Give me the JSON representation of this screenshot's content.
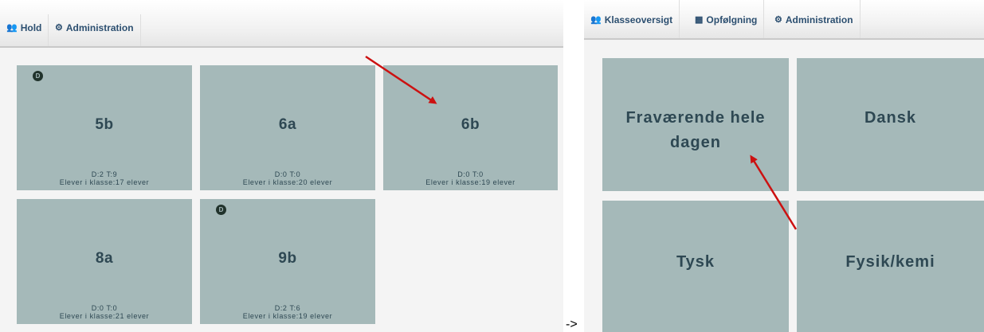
{
  "left_screen": {
    "nav": [
      {
        "icon": "users-icon",
        "label": "Hold"
      },
      {
        "icon": "gear-icon",
        "label": "Administration"
      }
    ],
    "badge_label": "D",
    "classes": [
      {
        "name": "5b",
        "stats": "D:2 T:9",
        "students": "Elever i klasse:17 elever",
        "badge": true
      },
      {
        "name": "6a",
        "stats": "D:0 T:0",
        "students": "Elever i klasse:20 elever",
        "badge": false
      },
      {
        "name": "6b",
        "stats": "D:0 T:0",
        "students": "Elever i klasse:19 elever",
        "badge": false
      },
      {
        "name": "8a",
        "stats": "D:0 T:0",
        "students": "Elever i klasse:21 elever",
        "badge": false
      },
      {
        "name": "9b",
        "stats": "D:2 T:6",
        "students": "Elever i klasse:19 elever",
        "badge": true
      }
    ]
  },
  "transition_label": "->",
  "right_screen": {
    "nav": [
      {
        "icon": "users-icon",
        "label": "Klasseoversigt"
      },
      {
        "icon": "bar-chart-icon",
        "label": "Opfølgning"
      },
      {
        "icon": "gear-icon",
        "label": "Administration"
      }
    ],
    "subjects": [
      {
        "lines": [
          "Fraværende hele",
          "dagen"
        ]
      },
      {
        "lines": [
          "Dansk"
        ]
      },
      {
        "lines": [
          "Tysk"
        ]
      },
      {
        "lines": [
          "Fysik/kemi"
        ]
      }
    ]
  },
  "colors": {
    "tile": "#a5b9b9",
    "text": "#2e4853",
    "nav_text": "#2c4f70",
    "arrow": "#cc1111"
  }
}
